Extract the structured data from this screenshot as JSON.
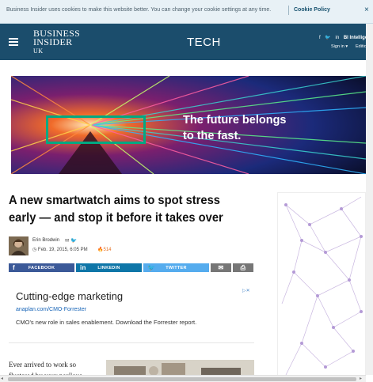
{
  "cookie_bar": {
    "text": "Business Insider uses cookies to make this website better. You can change your cookie settings at any time.",
    "link": "Cookie Policy",
    "close": "×"
  },
  "header": {
    "logo_line1": "BUSINESS",
    "logo_line2": "INSIDER",
    "logo_line3": "UK",
    "section": "TECH",
    "social": {
      "facebook": "f",
      "twitter": "🐦",
      "linkedin": "in",
      "bi_intelligence": "BI Intellige"
    },
    "sign_in": "Sign in ▾",
    "edition": "Editio"
  },
  "banner_ad": {
    "line1": "The future belongs",
    "line2": "to the fast."
  },
  "article": {
    "headline": "A new smartwatch aims to spot stress early — and stop it before it takes over",
    "author": "Erin Brodwin",
    "date": "Feb. 19, 2015, 6:05 PM",
    "views": "514",
    "body_start": "Ever arrived to work so flustered by your perilous"
  },
  "share": {
    "facebook": "FACEBOOK",
    "linkedin": "LINKEDIN",
    "twitter": "TWITTER"
  },
  "text_ad": {
    "title": "Cutting-edge marketing",
    "url": "anaplan.com/CMO-Forrester",
    "description": "CMO's new role in sales enablement. Download the Forrester report."
  },
  "colors": {
    "header_bg": "#1b4d6c",
    "cookie_bg": "#e8f1f6",
    "facebook": "#3b5998",
    "linkedin": "#0e76a8",
    "twitter": "#55acee",
    "hpe_green": "#01a982"
  }
}
